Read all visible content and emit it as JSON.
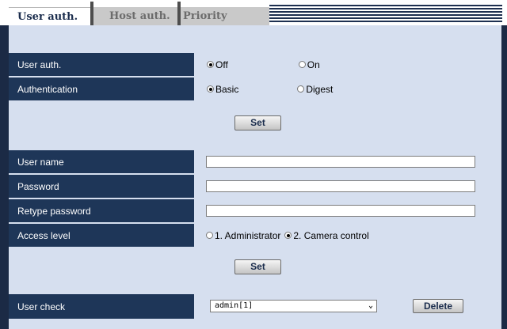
{
  "tabs": [
    {
      "label": "User auth."
    },
    {
      "label": "Host auth."
    },
    {
      "label": "Priority stream"
    }
  ],
  "auth_section": {
    "user_auth": {
      "label": "User auth.",
      "options": [
        "Off",
        "On"
      ],
      "selected": "Off"
    },
    "authentication": {
      "label": "Authentication",
      "options": [
        "Basic",
        "Digest"
      ],
      "selected": "Basic"
    },
    "set_label": "Set"
  },
  "user_section": {
    "user_name": {
      "label": "User name",
      "value": ""
    },
    "password": {
      "label": "Password",
      "value": ""
    },
    "retype_password": {
      "label": "Retype password",
      "value": ""
    },
    "access_level": {
      "label": "Access level",
      "options": [
        "1. Administrator",
        "2. Camera control"
      ],
      "selected": "2. Camera control"
    },
    "set_label": "Set"
  },
  "user_check": {
    "label": "User check",
    "selected_user": "admin[1]",
    "delete_label": "Delete"
  },
  "colors": {
    "label_bg": "#1e3658",
    "value_bg": "#d6dfef",
    "panel_bg": "#1b2a45"
  }
}
